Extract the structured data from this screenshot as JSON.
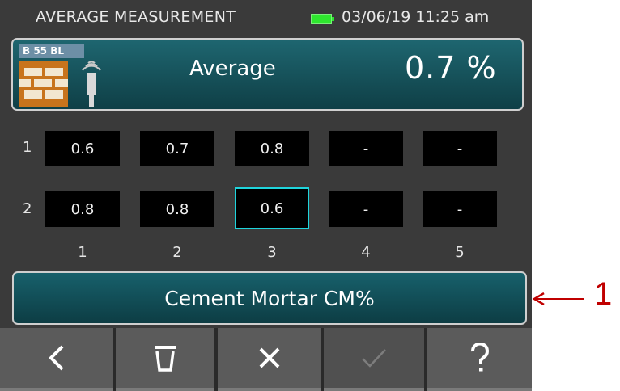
{
  "status": {
    "title": "AVERAGE MEASUREMENT",
    "datetime": "03/06/19 11:25 am",
    "battery_color": "#2ee62e"
  },
  "header": {
    "sensor_label": "B 55 BL",
    "mode": "Average",
    "value": "0.7 %"
  },
  "grid": {
    "rows": [
      {
        "label": "1",
        "cells": [
          "0.6",
          "0.7",
          "0.8",
          "-",
          "-"
        ]
      },
      {
        "label": "2",
        "cells": [
          "0.8",
          "0.8",
          "0.6",
          "-",
          "-"
        ]
      }
    ],
    "columns": [
      "1",
      "2",
      "3",
      "4",
      "5"
    ],
    "selected": {
      "row": 2,
      "col": 3
    },
    "selection_color": "#1fd4dc"
  },
  "material": {
    "label": "Cement Mortar CM%"
  },
  "toolbar": {
    "buttons": [
      {
        "name": "back",
        "icon": "chevron-left-icon",
        "enabled": true
      },
      {
        "name": "delete",
        "icon": "trash-icon",
        "enabled": true
      },
      {
        "name": "cancel",
        "icon": "close-icon",
        "enabled": true
      },
      {
        "name": "confirm",
        "icon": "check-icon",
        "enabled": false
      },
      {
        "name": "help",
        "icon": "question-icon",
        "enabled": true
      }
    ]
  },
  "callout": {
    "number": "1",
    "color": "#c00000"
  }
}
